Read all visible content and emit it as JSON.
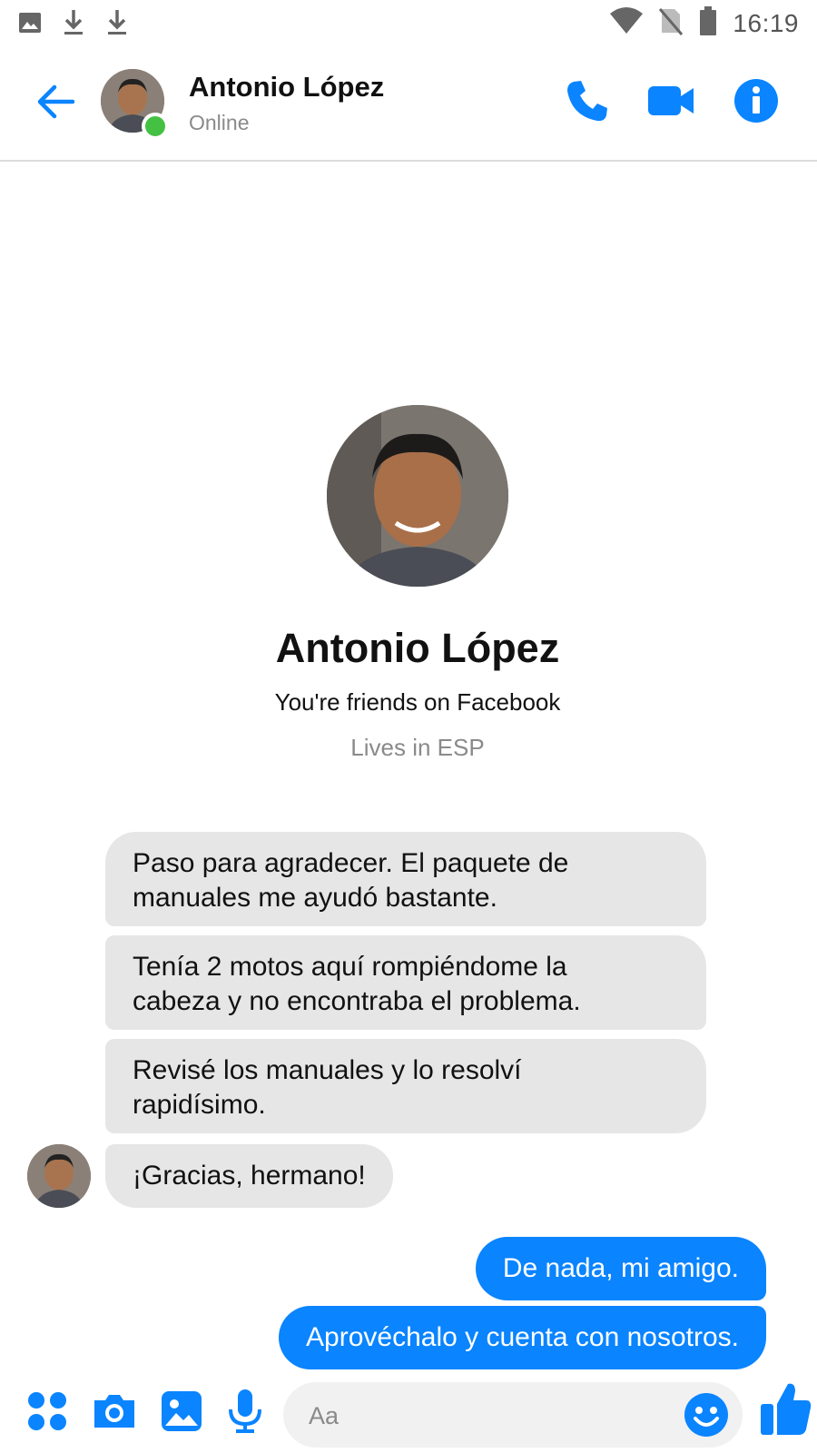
{
  "status_bar": {
    "time": "16:19",
    "left_icons": [
      "image-notification-icon",
      "download-icon",
      "download-icon"
    ],
    "right_icons": [
      "wifi-icon",
      "no-sim-icon",
      "battery-icon"
    ]
  },
  "header": {
    "name": "Antonio López",
    "status": "Online",
    "actions": [
      "phone-icon",
      "video-icon",
      "info-icon"
    ]
  },
  "profile": {
    "name": "Antonio López",
    "friends_text": "You're friends on Facebook",
    "lives_text": "Lives in ESP"
  },
  "messages": {
    "incoming": [
      {
        "line1": "Paso para agradecer. El paquete de",
        "line2": "manuales me ayudó bastante."
      },
      {
        "line1": "Tenía 2 motos aquí rompiéndome la",
        "line2": "cabeza y no encontraba el problema."
      },
      {
        "line1": "Revisé los manuales y lo resolví",
        "line2": "rapidísimo."
      },
      {
        "line1": "¡Gracias, hermano!"
      }
    ],
    "outgoing": [
      {
        "text": "De nada, mi amigo."
      },
      {
        "text": "Aprovéchalo y cuenta con nosotros."
      }
    ]
  },
  "composer": {
    "placeholder": "Aa",
    "icons": [
      "apps-icon",
      "camera-icon",
      "gallery-icon",
      "microphone-icon",
      "emoji-icon",
      "thumbs-up-icon"
    ]
  },
  "colors": {
    "accent": "#0a84ff",
    "online": "#44c043",
    "incoming_bubble": "#e6e6e6"
  }
}
